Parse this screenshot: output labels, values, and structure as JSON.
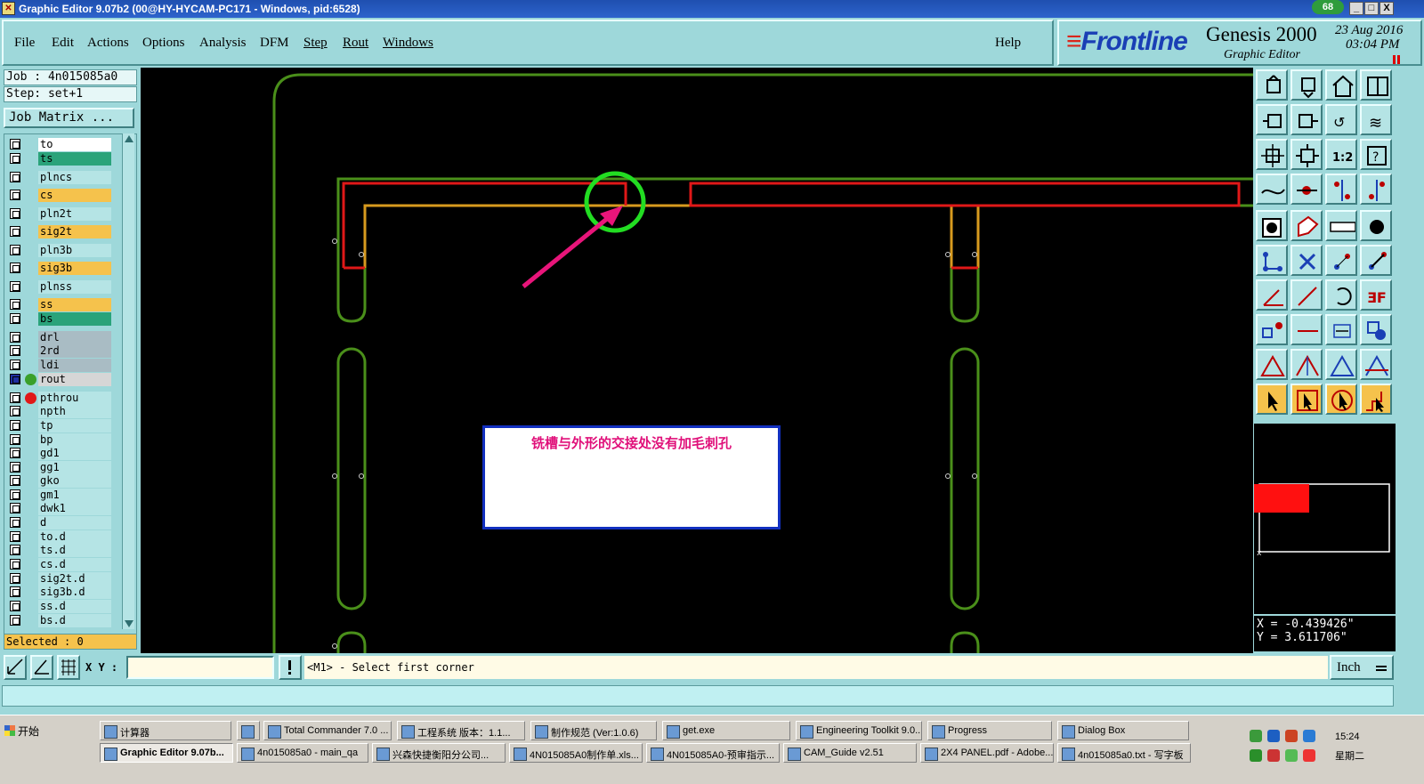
{
  "window": {
    "title": "Graphic Editor 9.07b2 (00@HY-HYCAM-PC171 - Windows, pid:6528)",
    "badge": "68",
    "minimize": "_",
    "maximize": "□",
    "close": "X"
  },
  "menu": [
    {
      "label": "File",
      "key": "menu-file"
    },
    {
      "label": "Edit",
      "key": "menu-edit"
    },
    {
      "label": "Actions",
      "key": "menu-actions"
    },
    {
      "label": "Options",
      "key": "menu-options"
    },
    {
      "label": "Analysis",
      "key": "menu-analysis"
    },
    {
      "label": "DFM",
      "key": "menu-dfm"
    },
    {
      "label": "Step",
      "key": "menu-step"
    },
    {
      "label": "Rout",
      "key": "menu-rout"
    },
    {
      "label": "Windows",
      "key": "menu-windows"
    },
    {
      "label": "Help",
      "key": "menu-help"
    }
  ],
  "brand": {
    "logo": "Frontline",
    "product": "Genesis 2000",
    "subtitle": "Graphic Editor",
    "date": "23 Aug 2016",
    "time": "03:04 PM"
  },
  "job": {
    "job_line": "Job : 4n015085a0",
    "step_line": "Step: set+1",
    "matrix_button": "Job Matrix ..."
  },
  "layers": [
    {
      "name": "to",
      "color": "#ffffff"
    },
    {
      "name": "ts",
      "color": "#2aa37a"
    },
    {
      "name": "plncs",
      "color": "#b5e4e5"
    },
    {
      "name": "cs",
      "color": "#f5c24c"
    },
    {
      "name": "pln2t",
      "color": "#b5e4e5"
    },
    {
      "name": "sig2t",
      "color": "#f5c24c"
    },
    {
      "name": "pln3b",
      "color": "#b5e4e5"
    },
    {
      "name": "sig3b",
      "color": "#f5c24c"
    },
    {
      "name": "plnss",
      "color": "#b5e4e5"
    },
    {
      "name": "ss",
      "color": "#f5c24c"
    },
    {
      "name": "bs",
      "color": "#2aa37a"
    },
    {
      "name": "drl",
      "color": "#a9bcc4"
    },
    {
      "name": "2rd",
      "color": "#a9bcc4"
    },
    {
      "name": "ldi",
      "color": "#a9bcc4"
    },
    {
      "name": "rout",
      "color": "#d6d6d6"
    },
    {
      "name": "pthrou",
      "color": "#b5e4e5"
    },
    {
      "name": "npth",
      "color": "#b5e4e5"
    },
    {
      "name": "tp",
      "color": "#b5e4e5"
    },
    {
      "name": "bp",
      "color": "#b5e4e5"
    },
    {
      "name": "gd1",
      "color": "#b5e4e5"
    },
    {
      "name": "gg1",
      "color": "#b5e4e5"
    },
    {
      "name": "gko",
      "color": "#b5e4e5"
    },
    {
      "name": "gm1",
      "color": "#b5e4e5"
    },
    {
      "name": "dwk1",
      "color": "#b5e4e5"
    },
    {
      "name": "d",
      "color": "#b5e4e5"
    },
    {
      "name": "to.d",
      "color": "#b5e4e5"
    },
    {
      "name": "ts.d",
      "color": "#b5e4e5"
    },
    {
      "name": "cs.d",
      "color": "#b5e4e5"
    },
    {
      "name": "sig2t.d",
      "color": "#b5e4e5"
    },
    {
      "name": "sig3b.d",
      "color": "#b5e4e5"
    },
    {
      "name": "ss.d",
      "color": "#b5e4e5"
    },
    {
      "name": "bs.d",
      "color": "#b5e4e5"
    }
  ],
  "selected_text": "Selected : 0",
  "canvas": {
    "annotation_text": "铣槽与外形的交接处没有加毛刺孔"
  },
  "coordinates": {
    "x_line": "X = -0.439426\"",
    "y_line": "Y = 3.611706\""
  },
  "command": {
    "xy_label": "X Y :",
    "xy_value": "",
    "prompt": "<M1> - Select first corner",
    "unit": "Inch"
  },
  "taskbar": {
    "start": "开始",
    "row1": [
      "计算器",
      "",
      "Total Commander 7.0 ...",
      "工程系统  版本：1.1...",
      "制作规范 (Ver:1.0.6)",
      "get.exe",
      "Engineering Toolkit 9.0...",
      "Progress",
      "Dialog Box"
    ],
    "row2": [
      "Graphic Editor 9.07b...",
      "4n015085a0 - main_qa",
      "兴森快捷衡阳分公司...",
      "4N015085A0制作单.xls...",
      "4N015085A0-预审指示...",
      "CAM_Guide v2.51",
      "2X4 PANEL.pdf - Adobe...",
      "4n015085a0.txt - 写字板"
    ],
    "clock": "15:24",
    "weekday": "星期二"
  },
  "colors": {
    "profile": "#4a8f1a",
    "rout_outline": "#e01818",
    "signal": "#d79a1e",
    "highlight_circle": "#22dd22",
    "arrow": "#e8157a"
  }
}
